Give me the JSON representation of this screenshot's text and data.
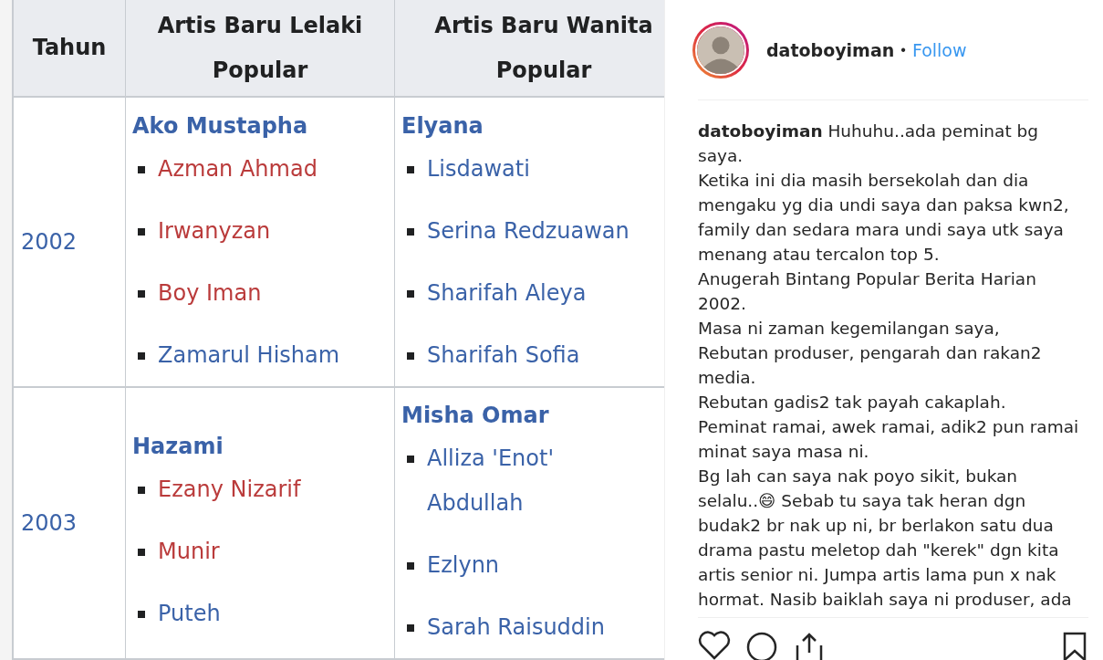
{
  "table": {
    "columns": [
      "Tahun",
      "Artis Baru Lelaki Popular",
      "Artis Baru Wanita Popular"
    ],
    "rows": [
      {
        "year": "2002",
        "male": {
          "winner": "Ako Mustapha",
          "nominees": [
            {
              "name": "Azman Ahmad",
              "color": "#ba3b3b"
            },
            {
              "name": "Irwanyzan",
              "color": "#ba3b3b"
            },
            {
              "name": "Boy Iman",
              "color": "#ba3b3b"
            },
            {
              "name": "Zamarul Hisham",
              "color": "#3a62a8"
            }
          ]
        },
        "female": {
          "winner": "Elyana",
          "nominees": [
            {
              "name": "Lisdawati",
              "color": "#3a62a8"
            },
            {
              "name": "Serina Redzuawan",
              "color": "#3a62a8"
            },
            {
              "name": "Sharifah Aleya",
              "color": "#3a62a8"
            },
            {
              "name": "Sharifah Sofia",
              "color": "#3a62a8"
            }
          ]
        }
      },
      {
        "year": "2003",
        "male": {
          "winner": "Hazami",
          "nominees": [
            {
              "name": "Ezany Nizarif",
              "color": "#ba3b3b"
            },
            {
              "name": "Munir",
              "color": "#ba3b3b"
            },
            {
              "name": "Puteh",
              "color": "#3a62a8"
            }
          ]
        },
        "female": {
          "winner": "Misha Omar",
          "nominees": [
            {
              "name": "Alliza 'Enot' Abdullah",
              "color": "#3a62a8"
            },
            {
              "name": "Ezlynn",
              "color": "#3a62a8"
            },
            {
              "name": "Sarah Raisuddin",
              "color": "#3a62a8"
            }
          ]
        }
      }
    ]
  },
  "post": {
    "username": "datoboyiman",
    "separator": "•",
    "follow": "Follow",
    "caption": [
      "**datoboyiman** Huhuhu..ada peminat bg saya.",
      "Ketika ini dia masih bersekolah dan dia mengaku yg dia undi saya dan paksa kwn2, family dan sedara mara undi saya utk saya menang atau tercalon top 5.",
      "Anugerah Bintang Popular Berita Harian 2002.",
      "Masa ni zaman kegemilangan saya,",
      "Rebutan produser, pengarah dan rakan2 media.",
      "Rebutan gadis2 tak payah cakaplah.",
      "Peminat ramai, awek ramai, adik2 pun ramai minat saya masa ni.",
      "Bg lah can saya nak poyo sikit, bukan selalu..😄 Sebab tu saya tak heran dgn budak2 br nak up ni, br berlakon satu dua drama pastu meletop dah \"kerek\" dgn kita artis senior ni. Jumpa artis lama pun x nak hormat. Nasib baiklah saya ni produser, ada"
    ]
  }
}
